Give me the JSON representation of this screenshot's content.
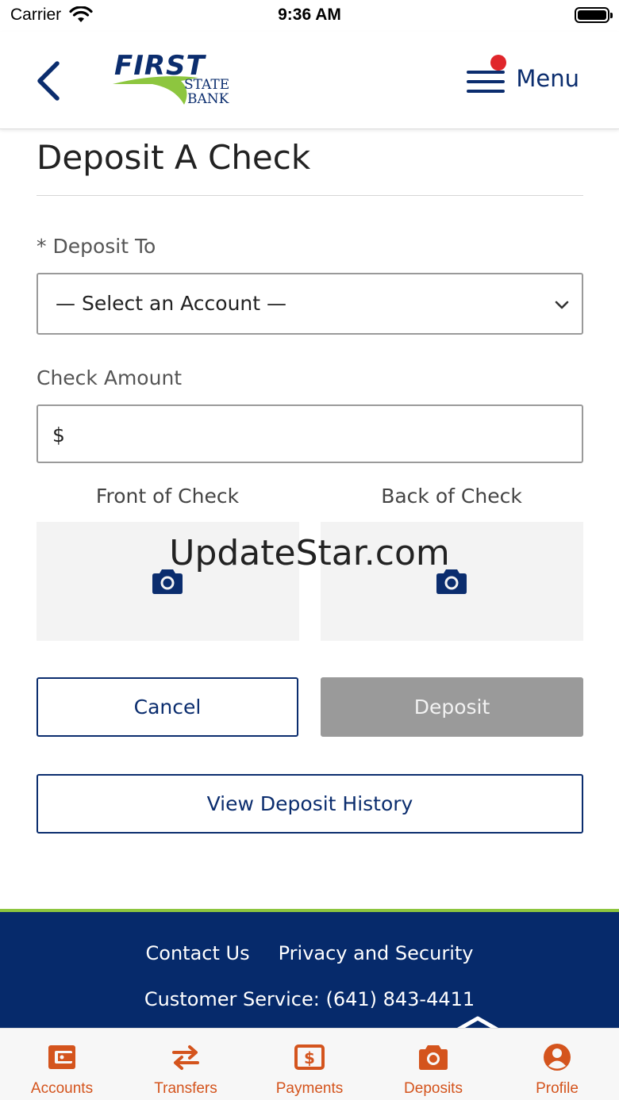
{
  "status_bar": {
    "carrier": "Carrier",
    "time": "9:36 AM"
  },
  "header": {
    "logo": {
      "brand_top": "FIRST",
      "brand_sub1": "STATE",
      "brand_sub2": "BANK"
    },
    "menu_label": "Menu",
    "menu_has_notification": true
  },
  "page": {
    "title": "Deposit A Check",
    "deposit_to_label": "* Deposit To",
    "account_select": {
      "selected": "— Select an Account —"
    },
    "amount_label": "Check Amount",
    "amount_prefix": "$",
    "amount_value": "",
    "front_label": "Front of Check",
    "back_label": "Back of Check",
    "watermark": "UpdateStar.com",
    "cancel_label": "Cancel",
    "deposit_label": "Deposit",
    "deposit_enabled": false,
    "history_label": "View Deposit History"
  },
  "footer": {
    "contact": "Contact Us",
    "privacy": "Privacy and Security",
    "service": "Customer Service: (641) 843-4411"
  },
  "tabs": [
    {
      "label": "Accounts",
      "icon": "wallet-icon"
    },
    {
      "label": "Transfers",
      "icon": "transfer-arrows-icon"
    },
    {
      "label": "Payments",
      "icon": "payment-dollar-icon"
    },
    {
      "label": "Deposits",
      "icon": "camera-icon"
    },
    {
      "label": "Profile",
      "icon": "user-circle-icon"
    }
  ],
  "colors": {
    "navy": "#0b2d6e",
    "accent_orange": "#d4541d",
    "brand_green": "#8dc63f",
    "disabled_gray": "#9a9a9a",
    "notification_red": "#e0262b"
  }
}
